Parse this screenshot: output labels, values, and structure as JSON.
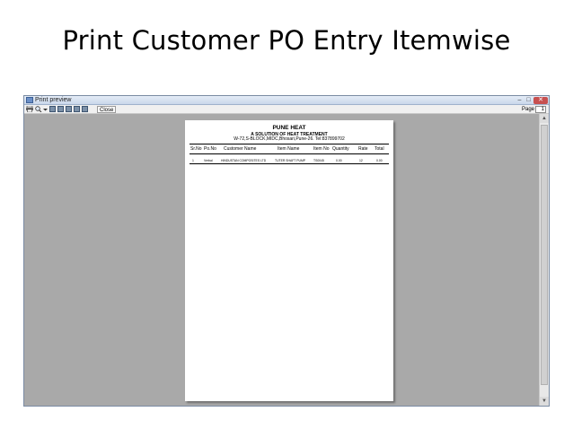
{
  "slide": {
    "title": "Print Customer PO Entry Itemwise"
  },
  "window": {
    "title": "Print preview",
    "controls": {
      "minimize": "–",
      "maximize": "□",
      "close": "✕"
    }
  },
  "toolbar": {
    "close_label": "Close",
    "page_label": "Page",
    "page_value": "1"
  },
  "report": {
    "company": "PUNE HEAT",
    "tagline": "A SOLUTION OF HEAT TREATMENT",
    "address": "W-72,S-BLOCK,MIDC,Bhosari,Pune-26. Tel:837899702",
    "columns": [
      "Sr.No",
      "Po.No",
      "Customer Name",
      "Item Name",
      "Item No",
      "Quantity",
      "Rate",
      "Total"
    ],
    "rows": [
      [
        "1",
        "Verbal",
        "HINDUSTAN COMPOSITES LTD",
        "TUTER SHAFT PUMP",
        "TS0045",
        "0.00",
        "12",
        "0.00"
      ]
    ]
  },
  "icons": [
    "printer-icon",
    "magnifier-icon",
    "dropdown-arrow-icon",
    "one-page-icon",
    "two-pages-icon",
    "three-pages-icon",
    "four-pages-icon",
    "six-pages-icon"
  ]
}
